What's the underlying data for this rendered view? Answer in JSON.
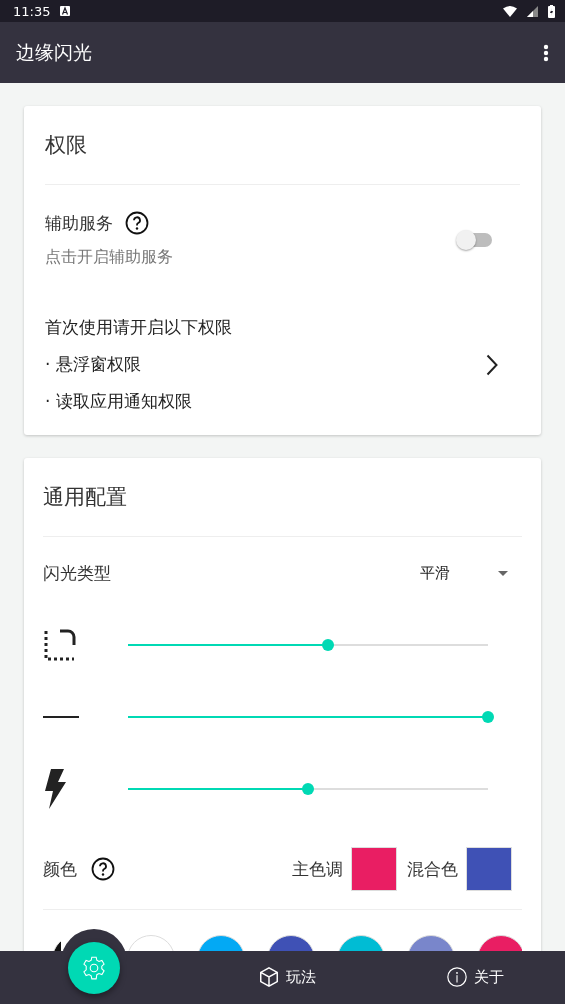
{
  "status_bar": {
    "time": "11:35"
  },
  "app_bar": {
    "title": "边缘闪光"
  },
  "permissions": {
    "title": "权限",
    "accessibility": {
      "label": "辅助服务",
      "hint": "点击开启辅助服务",
      "on": false
    },
    "required": {
      "lines": [
        "首次使用请开启以下权限",
        "· 悬浮窗权限",
        "· 读取应用通知权限"
      ]
    }
  },
  "general": {
    "title": "通用配置",
    "flash_type": {
      "label": "闪光类型",
      "value": "平滑"
    },
    "sliders": [
      {
        "kind": "corner",
        "level": 0.555
      },
      {
        "kind": "width",
        "level": 1.0
      },
      {
        "kind": "speed",
        "level": 0.5
      }
    ],
    "color": {
      "label": "颜色",
      "picks": [
        {
          "label": "主色调",
          "color": "#e91e63"
        },
        {
          "label": "混合色",
          "color": "#3f51b5"
        }
      ]
    },
    "swatches": [
      {
        "color": "#111111"
      },
      {
        "color": "#ffffff"
      },
      {
        "color": "#03a9f4"
      },
      {
        "color": "#3f51b5"
      },
      {
        "color": "#00bcd4"
      },
      {
        "color": "#7986cb"
      },
      {
        "color": "#e91e63"
      }
    ]
  },
  "bottom_nav": [
    {
      "kind": "settings",
      "selected": true
    },
    {
      "kind": "play",
      "label": "玩法",
      "selected": false
    },
    {
      "kind": "about",
      "label": "关于",
      "selected": false
    }
  ]
}
